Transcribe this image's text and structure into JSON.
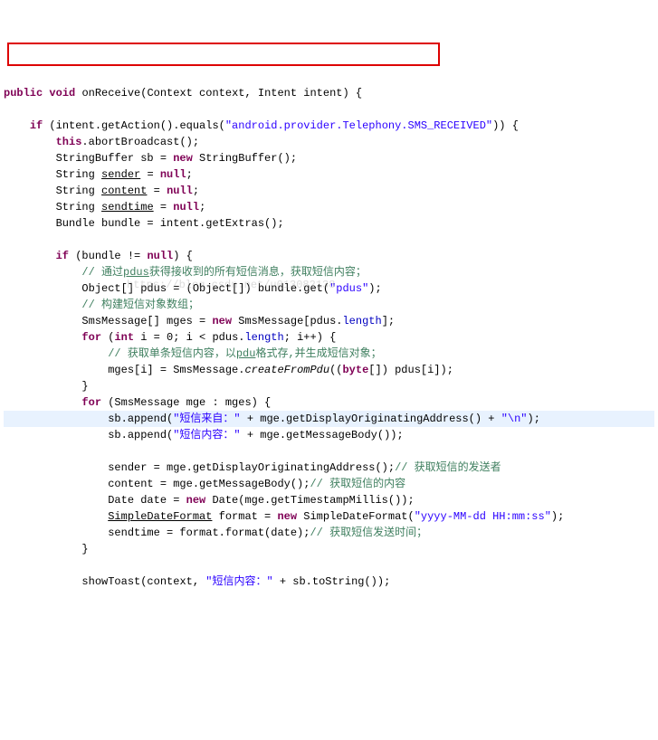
{
  "code": {
    "l1_kw_public": "public",
    "l1_kw_void": "void",
    "l1_method": "onReceive",
    "l1_rest": "(Context context, Intent intent) {",
    "l2_blank": "",
    "l3_indent": "    ",
    "l3_kw_if": "if",
    "l3_a": " (intent.getAction().equals(",
    "l3_str": "\"android.provider.Telephony.SMS_RECEIVED\"",
    "l3_b": ")) {",
    "l4_indent": "        ",
    "l4_kw_this": "this",
    "l4_rest": ".abortBroadcast();",
    "l5_indent": "        ",
    "l5_a": "StringBuffer sb = ",
    "l5_kw_new": "new",
    "l5_b": " StringBuffer();",
    "l6_indent": "        ",
    "l6_a": "String ",
    "l6_sender": "sender",
    "l6_b": " = ",
    "l6_kw_null": "null",
    "l6_c": ";",
    "l7_indent": "        ",
    "l7_a": "String ",
    "l7_content": "content",
    "l7_b": " = ",
    "l7_kw_null": "null",
    "l7_c": ";",
    "l8_indent": "        ",
    "l8_a": "String ",
    "l8_sendtime": "sendtime",
    "l8_b": " = ",
    "l8_kw_null": "null",
    "l8_c": ";",
    "l9_indent": "        ",
    "l9_text": "Bundle bundle = intent.getExtras();",
    "l10_blank": "",
    "l11_indent": "        ",
    "l11_kw_if": "if",
    "l11_rest": " (bundle != ",
    "l11_kw_null": "null",
    "l11_end": ") {",
    "l12_indent": "            ",
    "l12_cmt": "// 通过",
    "l12_pdus": "pdus",
    "l12_cmt2": "获得接收到的所有短信消息，获取短信内容；",
    "l13_indent": "            ",
    "l13_a": "Object[] pdus = (Object[]) bundle.get(",
    "l13_str": "\"pdus\"",
    "l13_b": ");",
    "l14_indent": "            ",
    "l14_cmt": "// 构建短信对象数组；",
    "l15_indent": "            ",
    "l15_a": "SmsMessage[] mges = ",
    "l15_kw_new": "new",
    "l15_b": " SmsMessage[pdus.",
    "l15_len": "length",
    "l15_c": "];",
    "l16_indent": "            ",
    "l16_kw_for": "for",
    "l16_a": " (",
    "l16_kw_int": "int",
    "l16_b": " i = 0; i < pdus.",
    "l16_len": "length",
    "l16_c": "; i++) {",
    "l17_indent": "                ",
    "l17_cmt": "// 获取单条短信内容，以",
    "l17_pdu": "pdu",
    "l17_cmt2": "格式存,并生成短信对象；",
    "l18_indent": "                ",
    "l18_a": "mges[i] = SmsMessage.",
    "l18_method": "createFromPdu",
    "l18_b": "((",
    "l18_kw_byte": "byte",
    "l18_c": "[]) pdus[i]);",
    "l19_indent": "            ",
    "l19_text": "}",
    "l20_indent": "            ",
    "l20_kw_for": "for",
    "l20_rest": " (SmsMessage mge : mges) {",
    "l21_indent": "                ",
    "l21_a": "sb.append(",
    "l21_str1": "\"短信来自：\"",
    "l21_b": " + mge.getDisplayOriginatingAddress() + ",
    "l21_str2": "\"\\n\"",
    "l21_c": ");",
    "l22_indent": "                ",
    "l22_a": "sb.append(",
    "l22_str": "\"短信内容：\"",
    "l22_b": " + mge.getMessageBody());",
    "l23_blank": "",
    "l24_indent": "                ",
    "l24_a": "sender = mge.getDisplayOriginatingAddress();",
    "l24_cmt": "// 获取短信的发送者",
    "l25_indent": "                ",
    "l25_a": "content = mge.getMessageBody();",
    "l25_cmt": "// 获取短信的内容",
    "l26_indent": "                ",
    "l26_a": "Date date = ",
    "l26_kw_new": "new",
    "l26_b": " Date(mge.getTimestampMillis());",
    "l27_indent": "                ",
    "l27_a": "SimpleDateFormat",
    "l27_sp": " format = ",
    "l27_kw_new": "new",
    "l27_b": " SimpleDateFormat(",
    "l27_str": "\"yyyy-MM-dd HH:mm:ss\"",
    "l27_c": ");",
    "l28_indent": "                ",
    "l28_a": "sendtime = format.format(date);",
    "l28_cmt": "// 获取短信发送时间；",
    "l29_indent": "            ",
    "l29_text": "}",
    "l30_blank": "",
    "l31_indent": "            ",
    "l31_a": "showToast(context, ",
    "l31_str": "\"短信内容：\"",
    "l31_b": " + sb.toString());"
  },
  "watermark": "https://blog.csdn.net/u013082138"
}
